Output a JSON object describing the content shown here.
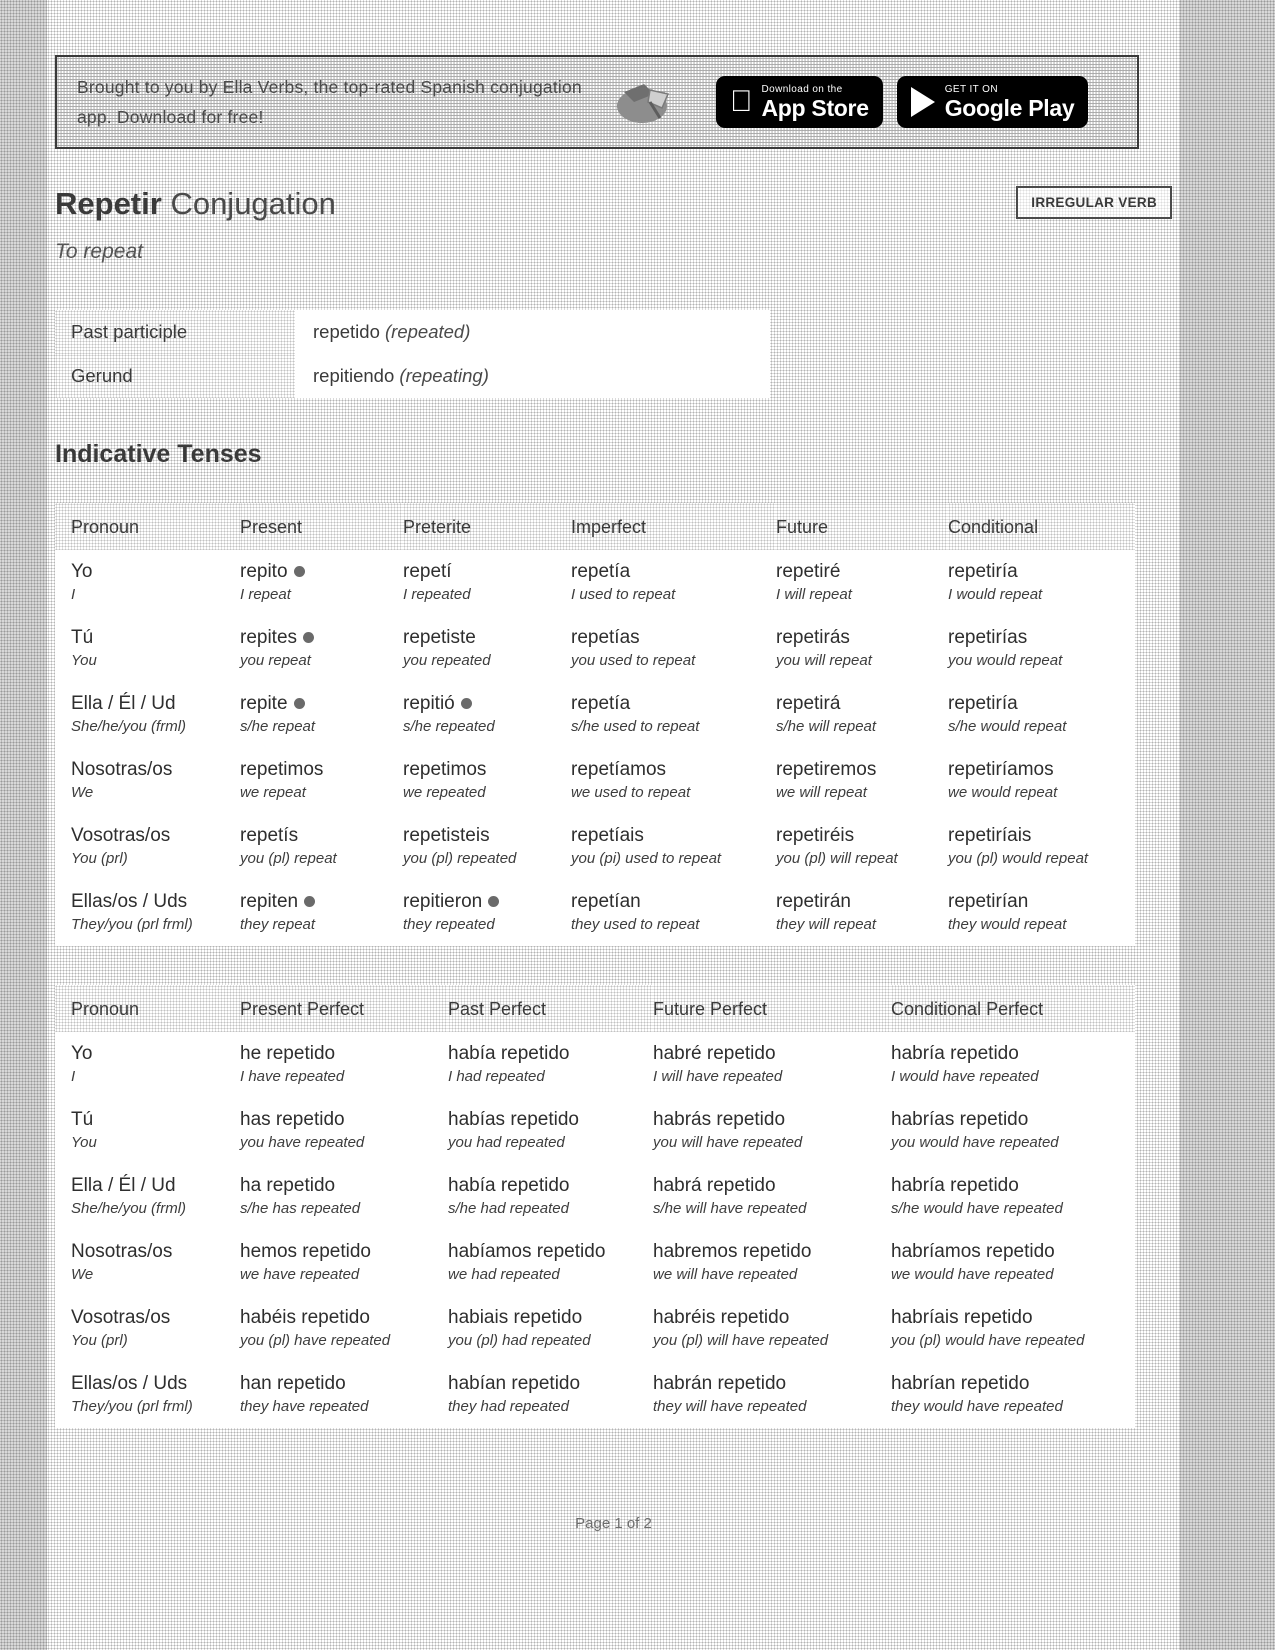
{
  "promo": {
    "text": "Brought to you by Ella Verbs, the top-rated Spanish conjugation app. Download for free!",
    "app_store": {
      "small": "Download on the",
      "big": "App Store"
    },
    "google_play": {
      "small": "GET IT ON",
      "big": "Google Play"
    }
  },
  "header": {
    "verb": "Repetir",
    "title_rest": "Conjugation",
    "translation": "To repeat",
    "badge": "IRREGULAR VERB"
  },
  "forms": {
    "rows": [
      {
        "label": "Past participle",
        "value": "repetido",
        "gloss": "(repeated)"
      },
      {
        "label": "Gerund",
        "value": "repitiendo",
        "gloss": "(repeating)"
      }
    ]
  },
  "indicative": {
    "heading": "Indicative Tenses",
    "columns": [
      "Pronoun",
      "Present",
      "Preterite",
      "Imperfect",
      "Future",
      "Conditional"
    ],
    "rows": [
      {
        "pronoun": "Yo",
        "pronoun_en": "I",
        "cells": [
          {
            "es": "repito",
            "en": "I repeat",
            "irregular": true
          },
          {
            "es": "repetí",
            "en": "I repeated",
            "irregular": false
          },
          {
            "es": "repetía",
            "en": "I used to repeat",
            "irregular": false
          },
          {
            "es": "repetiré",
            "en": "I will repeat",
            "irregular": false
          },
          {
            "es": "repetiría",
            "en": "I would repeat",
            "irregular": false
          }
        ]
      },
      {
        "pronoun": "Tú",
        "pronoun_en": "You",
        "cells": [
          {
            "es": "repites",
            "en": "you repeat",
            "irregular": true
          },
          {
            "es": "repetiste",
            "en": "you repeated",
            "irregular": false
          },
          {
            "es": "repetías",
            "en": "you used to repeat",
            "irregular": false
          },
          {
            "es": "repetirás",
            "en": "you will repeat",
            "irregular": false
          },
          {
            "es": "repetirías",
            "en": "you would repeat",
            "irregular": false
          }
        ]
      },
      {
        "pronoun": "Ella / Él / Ud",
        "pronoun_en": "She/he/you (frml)",
        "cells": [
          {
            "es": "repite",
            "en": "s/he repeat",
            "irregular": true
          },
          {
            "es": "repitió",
            "en": "s/he repeated",
            "irregular": true
          },
          {
            "es": "repetía",
            "en": "s/he used to repeat",
            "irregular": false
          },
          {
            "es": "repetirá",
            "en": "s/he will repeat",
            "irregular": false
          },
          {
            "es": "repetiría",
            "en": "s/he would repeat",
            "irregular": false
          }
        ]
      },
      {
        "pronoun": "Nosotras/os",
        "pronoun_en": "We",
        "cells": [
          {
            "es": "repetimos",
            "en": "we repeat",
            "irregular": false
          },
          {
            "es": "repetimos",
            "en": "we repeated",
            "irregular": false
          },
          {
            "es": "repetíamos",
            "en": "we used to repeat",
            "irregular": false
          },
          {
            "es": "repetiremos",
            "en": "we will repeat",
            "irregular": false
          },
          {
            "es": "repetiríamos",
            "en": "we would repeat",
            "irregular": false
          }
        ]
      },
      {
        "pronoun": "Vosotras/os",
        "pronoun_en": "You (prl)",
        "cells": [
          {
            "es": "repetís",
            "en": "you (pl) repeat",
            "irregular": false
          },
          {
            "es": "repetisteis",
            "en": "you (pl) repeated",
            "irregular": false
          },
          {
            "es": "repetíais",
            "en": "you (pi) used to repeat",
            "irregular": false
          },
          {
            "es": "repetiréis",
            "en": "you (pl) will repeat",
            "irregular": false
          },
          {
            "es": "repetiríais",
            "en": "you (pl) would repeat",
            "irregular": false
          }
        ]
      },
      {
        "pronoun": "Ellas/os / Uds",
        "pronoun_en": "They/you (prl frml)",
        "cells": [
          {
            "es": "repiten",
            "en": "they repeat",
            "irregular": true
          },
          {
            "es": "repitieron",
            "en": "they repeated",
            "irregular": true
          },
          {
            "es": "repetían",
            "en": "they used to repeat",
            "irregular": false
          },
          {
            "es": "repetirán",
            "en": "they will repeat",
            "irregular": false
          },
          {
            "es": "repetirían",
            "en": "they would repeat",
            "irregular": false
          }
        ]
      }
    ]
  },
  "perfect": {
    "columns": [
      "Pronoun",
      "Present Perfect",
      "Past Perfect",
      "Future Perfect",
      "Conditional Perfect"
    ],
    "rows": [
      {
        "pronoun": "Yo",
        "pronoun_en": "I",
        "cells": [
          {
            "es": "he repetido",
            "en": "I have repeated"
          },
          {
            "es": "había repetido",
            "en": "I had repeated"
          },
          {
            "es": "habré repetido",
            "en": "I will have repeated"
          },
          {
            "es": "habría repetido",
            "en": "I would have repeated"
          }
        ]
      },
      {
        "pronoun": "Tú",
        "pronoun_en": "You",
        "cells": [
          {
            "es": "has repetido",
            "en": "you have repeated"
          },
          {
            "es": "habías repetido",
            "en": "you had repeated"
          },
          {
            "es": "habrás repetido",
            "en": "you will have repeated"
          },
          {
            "es": "habrías repetido",
            "en": "you would have repeated"
          }
        ]
      },
      {
        "pronoun": "Ella / Él / Ud",
        "pronoun_en": "She/he/you (frml)",
        "cells": [
          {
            "es": "ha repetido",
            "en": "s/he has repeated"
          },
          {
            "es": "había repetido",
            "en": "s/he had repeated"
          },
          {
            "es": "habrá repetido",
            "en": "s/he will have repeated"
          },
          {
            "es": "habría repetido",
            "en": "s/he would have repeated"
          }
        ]
      },
      {
        "pronoun": "Nosotras/os",
        "pronoun_en": "We",
        "cells": [
          {
            "es": "hemos repetido",
            "en": "we have repeated"
          },
          {
            "es": "habíamos repetido",
            "en": "we had repeated"
          },
          {
            "es": "habremos repetido",
            "en": "we will have repeated"
          },
          {
            "es": "habríamos repetido",
            "en": "we would have repeated"
          }
        ]
      },
      {
        "pronoun": "Vosotras/os",
        "pronoun_en": "You (prl)",
        "cells": [
          {
            "es": "habéis repetido",
            "en": "you (pl) have repeated"
          },
          {
            "es": "habiais repetido",
            "en": "you (pl) had repeated"
          },
          {
            "es": "habréis repetido",
            "en": "you (pl) will have repeated"
          },
          {
            "es": "habríais repetido",
            "en": "you (pl) would have repeated"
          }
        ]
      },
      {
        "pronoun": "Ellas/os / Uds",
        "pronoun_en": "They/you (prl frml)",
        "cells": [
          {
            "es": "han repetido",
            "en": "they have repeated"
          },
          {
            "es": "habían repetido",
            "en": "they had repeated"
          },
          {
            "es": "habrán repetido",
            "en": "they will have repeated"
          },
          {
            "es": "habrían repetido",
            "en": "they would have repeated"
          }
        ]
      }
    ]
  },
  "footer": {
    "page": "Page 1 of 2"
  }
}
